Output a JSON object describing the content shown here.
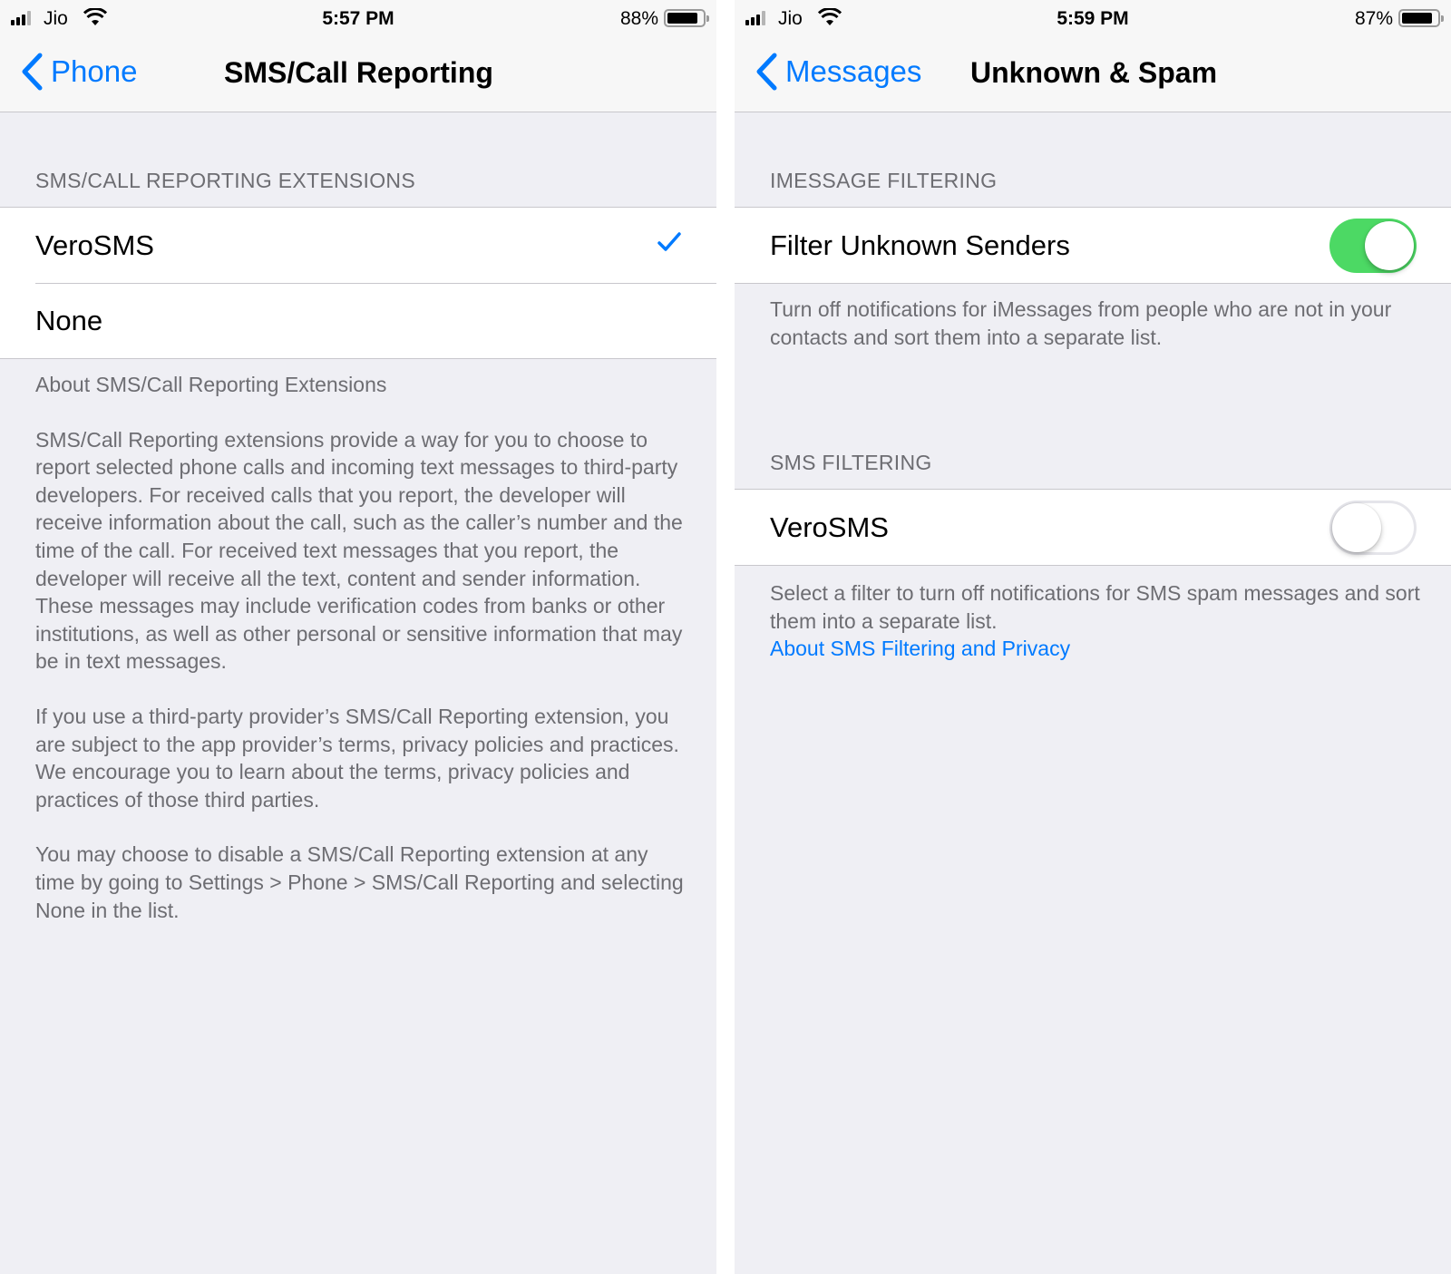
{
  "left": {
    "status": {
      "carrier": "Jio",
      "time": "5:57 PM",
      "battery_pct": "88%",
      "battery_level": 0.88
    },
    "nav": {
      "back_label": "Phone",
      "title": "SMS/Call Reporting"
    },
    "section_header": "SMS/Call Reporting Extensions",
    "options": [
      {
        "label": "VeroSMS",
        "selected": true
      },
      {
        "label": "None",
        "selected": false
      }
    ],
    "footer": {
      "heading": "About SMS/Call Reporting Extensions",
      "paragraphs": [
        "SMS/Call Reporting extensions provide a way for you to choose to report selected phone calls and incoming text messages to third-party developers. For received calls that you report, the developer will receive information about the call, such as the caller’s number and the time of the call. For received text messages that you report, the developer will receive all the text, content and sender information. These messages may include verification codes from banks or other institutions, as well as other personal or sensitive information that may be in text messages.",
        "If you use a third-party provider’s SMS/Call Reporting extension, you are subject to the app provider’s terms, privacy policies and practices. We encourage you to learn about the terms, privacy policies and practices of those third parties.",
        "You may choose to disable a SMS/Call Reporting extension at any time by going to Settings > Phone > SMS/Call Reporting and selecting None in the list."
      ]
    }
  },
  "right": {
    "status": {
      "carrier": "Jio",
      "time": "5:59 PM",
      "battery_pct": "87%",
      "battery_level": 0.87
    },
    "nav": {
      "back_label": "Messages",
      "title": "Unknown & Spam"
    },
    "imessage": {
      "section_header": "iMessage Filtering",
      "row_label": "Filter Unknown Senders",
      "toggle_on": true,
      "footer": "Turn off notifications for iMessages from people who are not in your contacts and sort them into a separate list."
    },
    "sms": {
      "section_header": "SMS Filtering",
      "row_label": "VeroSMS",
      "toggle_on": false,
      "footer": "Select a filter to turn off notifications for SMS spam messages and sort them into a separate list.",
      "link": "About SMS Filtering and Privacy"
    }
  },
  "colors": {
    "accent": "#007aff",
    "toggle_on": "#4cd964",
    "background": "#efeff4",
    "secondary_text": "#6d6d72"
  }
}
